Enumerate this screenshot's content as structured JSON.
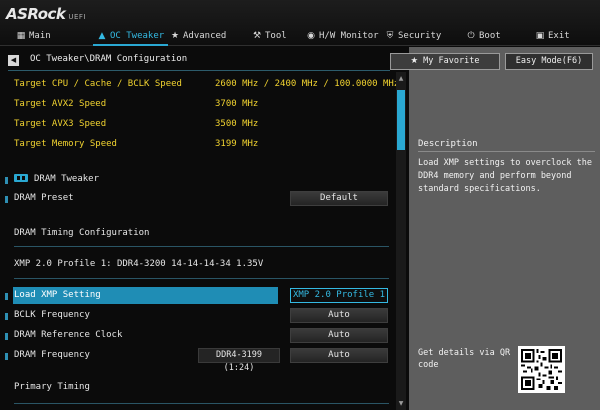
{
  "brand": {
    "name": "ASRock",
    "suffix": "UEFI"
  },
  "tabs": [
    {
      "label": "Main",
      "icon": "main-grid-icon",
      "active": false
    },
    {
      "label": "OC Tweaker",
      "icon": "flame-icon",
      "active": true
    },
    {
      "label": "Advanced",
      "icon": "star-icon",
      "active": false
    },
    {
      "label": "Tool",
      "icon": "wrench-icon",
      "active": false
    },
    {
      "label": "H/W Monitor",
      "icon": "monitor-icon",
      "active": false
    },
    {
      "label": "Security",
      "icon": "shield-icon",
      "active": false
    },
    {
      "label": "Boot",
      "icon": "power-icon",
      "active": false
    },
    {
      "label": "Exit",
      "icon": "exit-door-icon",
      "active": false
    }
  ],
  "breadcrumb": "OC Tweaker\\DRAM Configuration",
  "targets": [
    {
      "label": "Target CPU / Cache / BCLK Speed",
      "value": "2600 MHz / 2400 MHz / 100.0000 MHz"
    },
    {
      "label": "Target AVX2 Speed",
      "value": "3700 MHz"
    },
    {
      "label": "Target AVX3 Speed",
      "value": "3500 MHz"
    },
    {
      "label": "Target Memory Speed",
      "value": "3199 MHz"
    }
  ],
  "dram_tweaker": {
    "label": "DRAM Tweaker"
  },
  "dram_preset": {
    "label": "DRAM Preset",
    "value": "Default"
  },
  "timing_config": {
    "label": "DRAM Timing Configuration"
  },
  "xmp_profile_info": "XMP 2.0 Profile 1: DDR4-3200 14-14-14-34 1.35V",
  "settings": {
    "load_xmp": {
      "label": "Load XMP Setting",
      "value": "XMP 2.0 Profile 1"
    },
    "bclk_freq": {
      "label": "BCLK Frequency",
      "value": "Auto"
    },
    "dram_ref_clock": {
      "label": "DRAM Reference Clock",
      "value": "Auto"
    },
    "dram_freq": {
      "label": "DRAM Frequency",
      "value": "Auto",
      "current": "DDR4-3199 (1:24)"
    }
  },
  "primary_timing": {
    "label": "Primary Timing"
  },
  "right_panel": {
    "favorite_label": "My Favorite",
    "easy_mode_label": "Easy Mode(F6)",
    "description_title": "Description",
    "description_text": "Load XMP settings to overclock the DDR4 memory and perform beyond standard specifications.",
    "qr_text": "Get details via QR code"
  },
  "colors": {
    "accent": "#2aa8d2",
    "value_yellow": "#f0d230",
    "panel_gray": "#5e5e5e",
    "background": "#0b0b0b"
  }
}
